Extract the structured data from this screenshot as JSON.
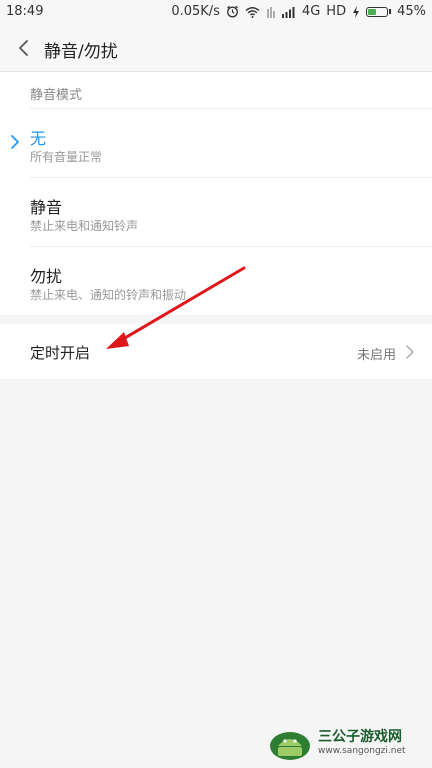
{
  "status_bar": {
    "time": "18:49",
    "speed": "0.05K/s",
    "network": "4G",
    "hd": "HD",
    "battery": "45%",
    "battery_level": 0.45
  },
  "header": {
    "title": "静音/勿扰"
  },
  "mode_section": {
    "label": "静音模式",
    "options": [
      {
        "title": "无",
        "subtitle": "所有音量正常",
        "selected": true
      },
      {
        "title": "静音",
        "subtitle": "禁止来电和通知铃声",
        "selected": false
      },
      {
        "title": "勿扰",
        "subtitle": "禁止来电、通知的铃声和振动",
        "selected": false
      }
    ]
  },
  "schedule_row": {
    "title": "定时开启",
    "value": "未启用"
  },
  "watermark": {
    "name": "三公子游戏网",
    "url": "www.sangongzi.net"
  },
  "colors": {
    "accent": "#2196f3",
    "annotation_arrow": "#e0161b"
  }
}
